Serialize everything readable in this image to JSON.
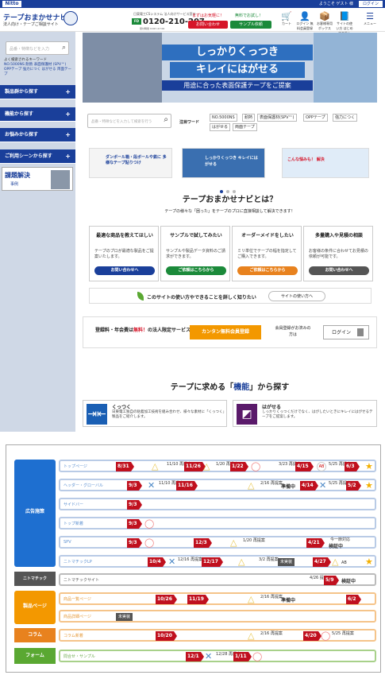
{
  "topbar": {
    "logo": "Nitto",
    "welcome": "ようこそ ゲスト 様",
    "login": "ログイン"
  },
  "header": {
    "brand": "テープおまかせナビ",
    "brand_sub": "法人向け・テープご相談サイト",
    "tel_top": "日東電工CSシステム 法人向けサービス窓口",
    "tel": "0120-210-207",
    "tel_sub": "受付時間 9:00～17:00",
    "inquiry_caption": "まずはお気軽に！",
    "inquiry_label": "お問い合わせ",
    "sample_caption": "無料でお試し！",
    "sample_label": "サンプル依頼",
    "icons": [
      {
        "icon": "cart-icon",
        "glyph": "🛒",
        "label": "カート"
      },
      {
        "icon": "user-icon",
        "glyph": "👤",
        "label": "ログイン 無料会員登録"
      },
      {
        "icon": "box-icon",
        "glyph": "📦",
        "label": "お客様専用 ボックス"
      },
      {
        "icon": "guide-icon",
        "glyph": "📘",
        "label": "サイトの使い方 はじめての方へ"
      },
      {
        "icon": "menu-icon",
        "glyph": "☰",
        "label": "メニュー"
      }
    ]
  },
  "sidebar": {
    "search_placeholder": "品番・特徴などを入力",
    "kw_title": "よく検索されるキーワード",
    "keywords": "NO.5000NS 耐熱 表面保護材 (SPV™) OPPテープ 強力につく はがせる 両面テープ",
    "nav": [
      "製品群から探す",
      "機能から探す",
      "お悩みから探す",
      "ご利用シーンから探す"
    ],
    "issue_title": "課題解決",
    "issue_sub": "事例"
  },
  "hero": {
    "line1": "しっかりくっつき",
    "line2": "キレイにはがせる",
    "line3": "用途に合った表面保護テープをご提案"
  },
  "main": {
    "search_placeholder": "品番・特徴などを入力して検索を行う",
    "kw_label": "注目ワード",
    "chips": [
      "NO.5000NS",
      "耐熱",
      "表面保護材(SPV™)",
      "OPPテープ",
      "強力につく",
      "はがせる",
      "両面テープ"
    ],
    "banners": [
      "ダンボール箱・段ボールや鉄に 多様なテープ貼りつけ",
      "しっかりくっつき キレイにはがせる",
      "こんな悩みも！ 解決"
    ],
    "what_title": "テープおまかせナビとは？",
    "what_sub": "テープの様々な「困った」をテープのプロに直接相談して解決できます！",
    "cards": [
      {
        "title": "最適な商品を教えてほしい",
        "desc": "テープのプロが最適な製品をご提案いたします。",
        "btn": "お問い合わせへ",
        "color": "#1a3f9a"
      },
      {
        "title": "サンプルで試してみたい",
        "desc": "サンプルや製品データ資料のご請求ができます。",
        "btn": "ご依頼はこちらから",
        "color": "#1b8a3a"
      },
      {
        "title": "オーダーメイドをしたい",
        "desc": "ミリ単位でテープの幅を指定してご購入できます。",
        "btn": "ご依頼はこちらから",
        "color": "#e8821e"
      },
      {
        "title": "多量購入や見積の相談",
        "desc": "お客様の条件に合わせてお見積の依頼が可能です。",
        "btn": "お問い合わせへ",
        "color": "#555555"
      }
    ],
    "howto_text": "このサイトの使い方やできることを詳しく知りたい",
    "howto_btn": "サイトの使い方へ",
    "reg_text1": "登録料・年会費は",
    "reg_free": "無料！",
    "reg_text2": "の法人限定サービス",
    "reg_btn": "カンタン無料会員登録",
    "reg_note": "会員登録がお済みの方は",
    "reg_login": "ログイン",
    "func_pre": "テープに求める「",
    "func_key": "機能",
    "func_post": "」から探す",
    "func_cards": [
      {
        "title": "くっつく",
        "desc": "日東電工独自の粘着加工技術を組み合わせ、様々な素材に「くっつく」製品をご紹介します。",
        "glyph": "⇥⇤",
        "color": "#1a5fb4"
      },
      {
        "title": "はがせる",
        "desc": "しっかりくっつくだけでなく、はがしたいときにキレイにはがせるテープをご提案します。",
        "glyph": "◩",
        "color": "#5a1a6a"
      }
    ]
  },
  "schedule": {
    "groups": [
      {
        "label": "広告施策",
        "color": "#1e6fd0"
      },
      {
        "label": "ニトマチック",
        "color": "#555555"
      },
      {
        "label": "製品ページ",
        "color": "#f39800"
      },
      {
        "label": "コラム",
        "color": "#e8821e"
      },
      {
        "label": "フォーム",
        "color": "#5aa832"
      }
    ],
    "rows": [
      {
        "page": "トップページ",
        "dates": [
          "8/31",
          "11/26",
          "1/22",
          "4/15",
          "6/3"
        ],
        "notes": [
          "11/10 再提案",
          "1/20 再提案",
          "3/23 再提案",
          "5/25 再提案"
        ],
        "ab": "AB"
      },
      {
        "page": "ヘッダー・グローバル",
        "dates": [
          "9/3",
          "11/16",
          "4/14",
          "5/2"
        ],
        "notes": [
          "11/10 再提案",
          "2/16 再提案",
          "5/25 再提案"
        ],
        "text": [
          "準備中"
        ]
      },
      {
        "page": "サイドバー",
        "dates": [
          "9/3"
        ]
      },
      {
        "page": "トップ新着",
        "dates": [
          "9/3"
        ]
      },
      {
        "page": "SPV",
        "dates": [
          "9/3",
          "12/3",
          "4/21"
        ],
        "notes": [
          "1/20 再提案",
          "今一節対応"
        ],
        "text": [
          "検証中"
        ]
      },
      {
        "page": "ニトマチックLP",
        "dates": [
          "10/4",
          "12/17",
          "4/27"
        ],
        "notes": [
          "12/16 再提案",
          "3/2 再提案"
        ],
        "tag": "未実装",
        "ab": "AB"
      },
      {
        "page": "ニトマチックサイト",
        "dates": [
          "5/9"
        ],
        "notes": [
          "4/26 提案"
        ],
        "text": [
          "検証中"
        ]
      },
      {
        "page": "商品一覧ページ",
        "dates": [
          "10/26",
          "11/19",
          "6/2"
        ],
        "notes": [
          "2/16 再提案"
        ],
        "text": [
          "準備中"
        ]
      },
      {
        "page": "商品詳細ページ",
        "tag": "未実装"
      },
      {
        "page": "コラム新着",
        "dates": [
          "10/20",
          "4/20"
        ],
        "notes": [
          "2/16 再提案",
          "5/25 再提案"
        ]
      },
      {
        "page": "問合せ・サンプル",
        "dates": [
          "12/1",
          "1/11"
        ],
        "notes": [
          "12/28 再提案"
        ]
      }
    ]
  },
  "colors": {
    "brand": "#1a3f9a",
    "red": "#d6162a",
    "green": "#1b8a3a",
    "orange": "#f39800"
  }
}
